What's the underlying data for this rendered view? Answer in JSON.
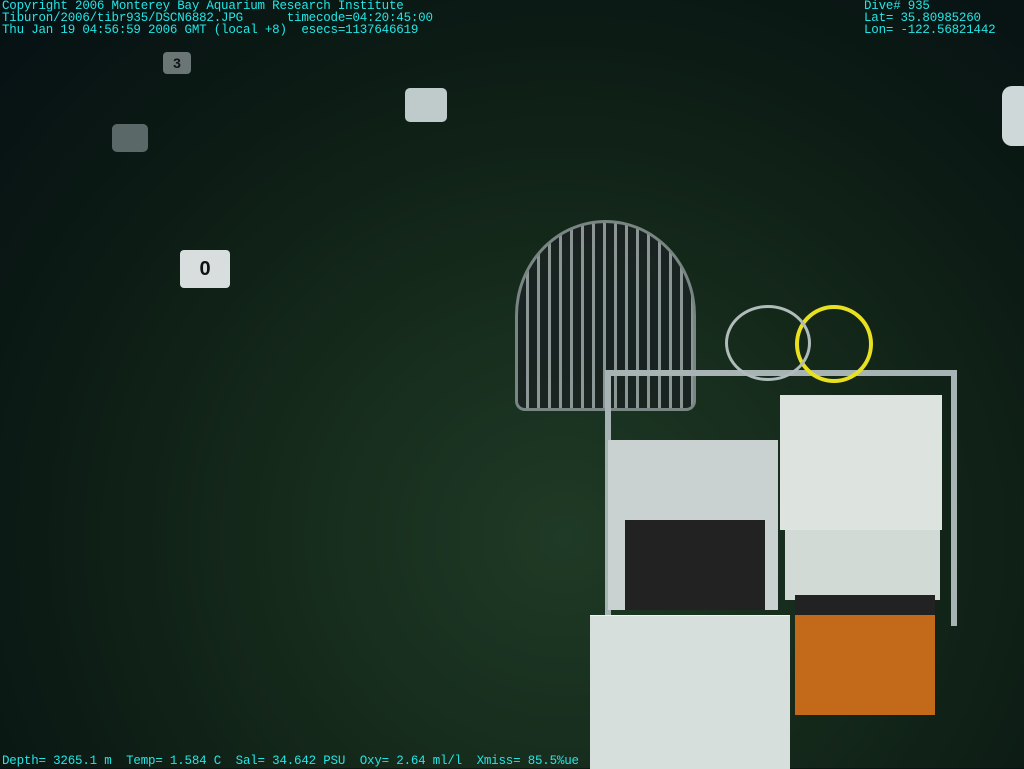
{
  "header_left": {
    "line1": "Copyright 2006 Monterey Bay Aquarium Research Institute",
    "line2": "Tiburon/2006/tibr935/DSCN6882.JPG      timecode=04:20:45:00",
    "line3": "Thu Jan 19 04:56:59 2006 GMT (local +8)  esecs=1137646619"
  },
  "header_right": {
    "dive": "Dive# 935",
    "lat": "Lat= 35.80985260",
    "lon": "Lon= -122.56821442"
  },
  "footer": {
    "text": "Depth= 3265.1 m  Temp= 1.584 C  Sal= 34.642 PSU  Oxy= 2.64 ml/l  Xmiss= 85.5%ue"
  },
  "markers": {
    "m1": "0",
    "m2": "3"
  },
  "colors": {
    "overlay_text": "#22e6e6",
    "seafloor": "#1f3a26"
  }
}
